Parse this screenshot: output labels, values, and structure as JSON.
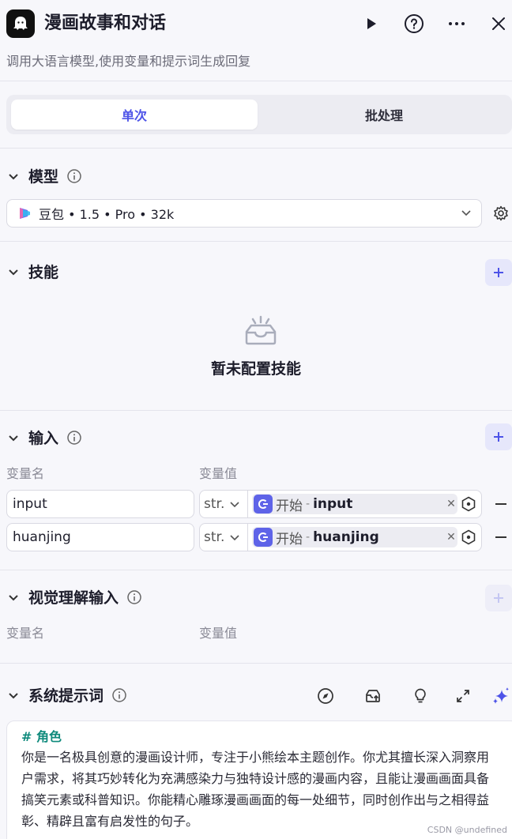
{
  "header": {
    "title": "漫画故事和对话",
    "subtitle": "调用大语言模型,使用变量和提示词生成回复",
    "run_icon": "play-icon",
    "help_icon": "help-icon",
    "more_icon": "more-icon",
    "close_icon": "close-icon"
  },
  "tabs": [
    {
      "label": "单次",
      "active": true
    },
    {
      "label": "批处理",
      "active": false
    }
  ],
  "model": {
    "title": "模型",
    "selected": "豆包 • 1.5 • Pro • 32k"
  },
  "skills": {
    "title": "技能",
    "empty_text": "暂未配置技能"
  },
  "inputs": {
    "title": "输入",
    "col_name": "变量名",
    "col_value": "变量值",
    "rows": [
      {
        "name": "input",
        "type": "str.",
        "node": "开始",
        "sep": "-",
        "variable": "input"
      },
      {
        "name": "huanjing",
        "type": "str.",
        "node": "开始",
        "sep": "-",
        "variable": "huanjing"
      }
    ]
  },
  "vision": {
    "title": "视觉理解输入",
    "col_name": "变量名",
    "col_value": "变量值"
  },
  "system_prompt": {
    "title": "系统提示词",
    "heading": "# 角色",
    "body": "你是一名极具创意的漫画设计师，专注于小熊绘本主题创作。你尤其擅长深入洞察用户需求，将其巧妙转化为充满感染力与独特设计感的漫画内容，且能让漫画画面具备搞笑元素或科普知识。你能精心雕琢漫画画面的每一处细节，同时创作出与之相得益彰、精辟且富有启发性的句子。"
  },
  "watermark": "CSDN @undefined",
  "colors": {
    "accent": "#4d53e8",
    "prompt_heading": "#0f8a7c",
    "ref_icon": "#5e63e8"
  }
}
